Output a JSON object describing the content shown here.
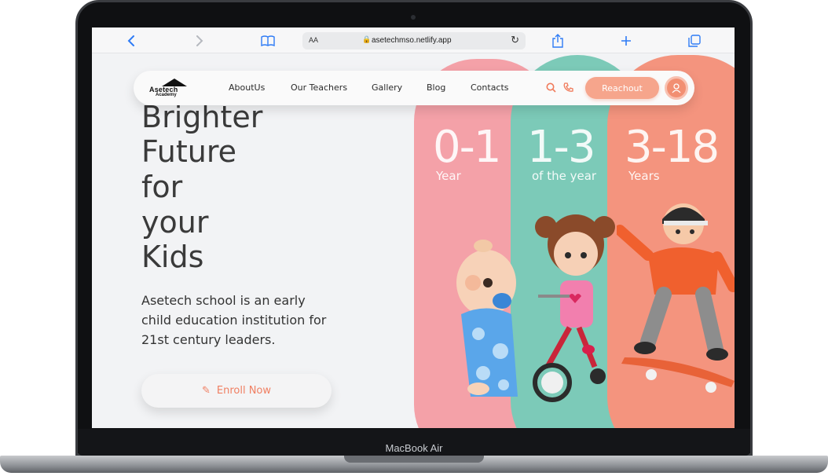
{
  "device": {
    "label": "MacBook Air"
  },
  "browser": {
    "url": "asetechmso.netlify.app",
    "text_size_label": "AA",
    "back_icon": "chevron-left-icon",
    "forward_icon": "chevron-right-icon",
    "bookmarks_icon": "book-icon",
    "share_icon": "share-icon",
    "new_tab_icon": "plus-icon",
    "tabs_icon": "tabs-icon"
  },
  "nav": {
    "logo_text": "Asetech",
    "logo_subtext": "Academy",
    "links": [
      "AboutUs",
      "Our Teachers",
      "Gallery",
      "Blog",
      "Contacts"
    ],
    "search_icon": "search-icon",
    "phone_icon": "phone-icon",
    "cta_label": "Reachout",
    "avatar_icon": "user-icon"
  },
  "hero": {
    "lines": [
      "Brighter",
      "Future",
      "for",
      "your",
      "Kids"
    ],
    "description_lines": [
      "Asetech school is an early",
      "child education institution for",
      "21st century leaders."
    ],
    "enroll_label": "Enroll Now",
    "enroll_icon": "pencil-icon"
  },
  "age_groups": [
    {
      "range": "0-1",
      "label": "Year",
      "color": "#f4a1a8"
    },
    {
      "range": "1-3",
      "label": "of the year",
      "color": "#7ccab8"
    },
    {
      "range": "3-18",
      "label": "Years",
      "color": "#f4947e"
    }
  ],
  "colors": {
    "accent": "#f07a5a",
    "button": "#f6a58c",
    "text": "#3a3a3a"
  }
}
